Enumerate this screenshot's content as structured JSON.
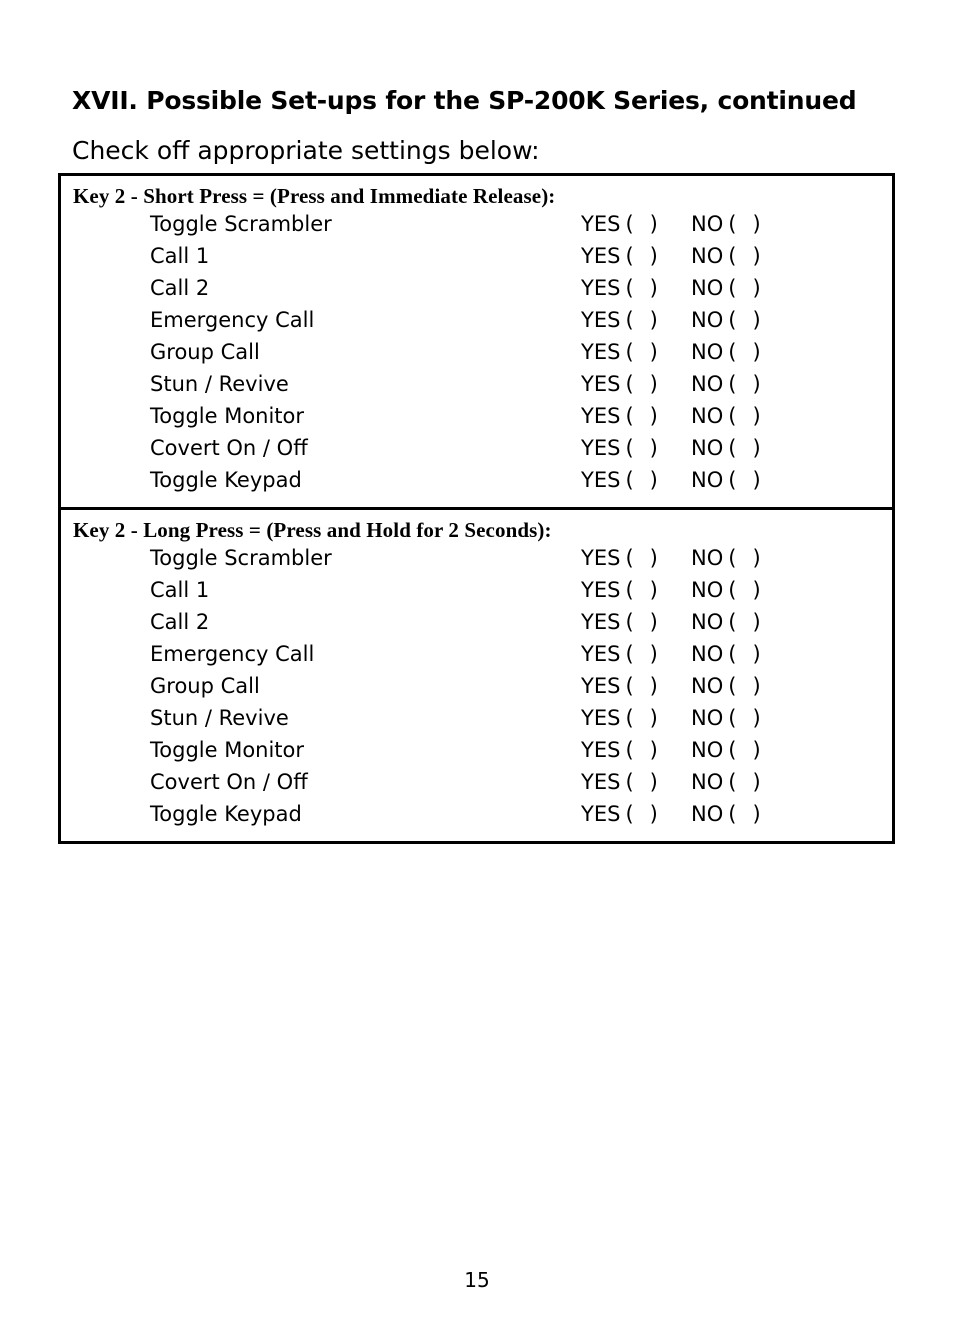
{
  "document": {
    "title": "XVII.  Possible Set-ups for the SP-200K Series, continued",
    "subtitle": "Check off appropriate settings below:",
    "page_number": "15"
  },
  "options": {
    "yes_label": "YES",
    "no_label": "NO",
    "paren_open": "(",
    "paren_close": ")"
  },
  "table": {
    "sections": [
      {
        "header": "Key 2 - Short Press  =  (Press and Immediate Release):",
        "rows": [
          {
            "label": "Toggle Scrambler",
            "yes_checked": "",
            "no_checked": ""
          },
          {
            "label": "Call 1",
            "yes_checked": "",
            "no_checked": ""
          },
          {
            "label": "Call 2",
            "yes_checked": "",
            "no_checked": ""
          },
          {
            "label": "Emergency Call",
            "yes_checked": "",
            "no_checked": ""
          },
          {
            "label": "Group Call",
            "yes_checked": "",
            "no_checked": ""
          },
          {
            "label": "Stun / Revive",
            "yes_checked": "",
            "no_checked": ""
          },
          {
            "label": "Toggle Monitor",
            "yes_checked": "",
            "no_checked": ""
          },
          {
            "label": "Covert On / Off",
            "yes_checked": "",
            "no_checked": ""
          },
          {
            "label": "Toggle Keypad",
            "yes_checked": "",
            "no_checked": ""
          }
        ]
      },
      {
        "header": "Key 2 - Long Press  =  (Press and Hold for 2 Seconds):",
        "rows": [
          {
            "label": "Toggle Scrambler",
            "yes_checked": "",
            "no_checked": ""
          },
          {
            "label": "Call 1",
            "yes_checked": "",
            "no_checked": ""
          },
          {
            "label": "Call 2",
            "yes_checked": "",
            "no_checked": ""
          },
          {
            "label": "Emergency Call",
            "yes_checked": "",
            "no_checked": ""
          },
          {
            "label": "Group Call",
            "yes_checked": "",
            "no_checked": ""
          },
          {
            "label": "Stun / Revive",
            "yes_checked": "",
            "no_checked": ""
          },
          {
            "label": "Toggle Monitor",
            "yes_checked": "",
            "no_checked": ""
          },
          {
            "label": "Covert On / Off",
            "yes_checked": "",
            "no_checked": ""
          },
          {
            "label": "Toggle Keypad",
            "yes_checked": "",
            "no_checked": ""
          }
        ]
      }
    ]
  }
}
